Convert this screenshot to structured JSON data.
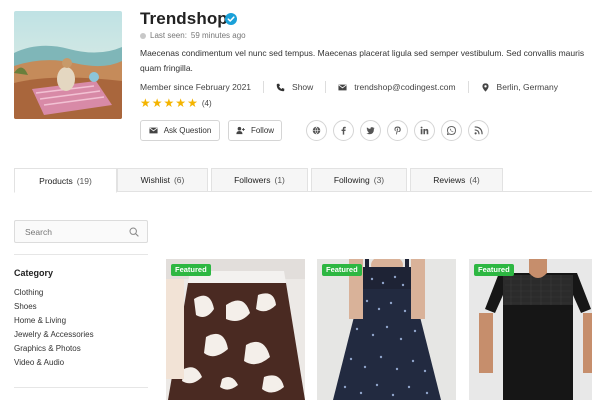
{
  "profile": {
    "name": "Trendshop",
    "last_seen_label": "Last seen:",
    "last_seen_value": "59 minutes ago",
    "bio": "Maecenas condimentum vel nunc sed tempus. Maecenas placerat ligula sed semper vestibulum. Sed convallis mauris quam fringilla.",
    "member_since": "Member since February 2021",
    "phone_label": "Show",
    "email": "trendshop@codingest.com",
    "location": "Berlin, Germany",
    "rating_stars": 5,
    "rating_count": "(4)"
  },
  "actions": {
    "ask_question": "Ask Question",
    "follow": "Follow"
  },
  "social_icons": [
    "globe-icon",
    "facebook-icon",
    "twitter-icon",
    "pinterest-icon",
    "linkedin-icon",
    "whatsapp-icon",
    "rss-icon"
  ],
  "tabs": [
    {
      "label": "Products",
      "count": "(19)",
      "active": true
    },
    {
      "label": "Wishlist",
      "count": "(6)",
      "active": false
    },
    {
      "label": "Followers",
      "count": "(1)",
      "active": false
    },
    {
      "label": "Following",
      "count": "(3)",
      "active": false
    },
    {
      "label": "Reviews",
      "count": "(4)",
      "active": false
    }
  ],
  "sidebar": {
    "search_placeholder": "Search",
    "category_title": "Category",
    "categories": [
      "Clothing",
      "Shoes",
      "Home & Living",
      "Jewelry & Accessories",
      "Graphics & Photos",
      "Video & Audio"
    ]
  },
  "products": [
    {
      "badge": "Featured"
    },
    {
      "badge": "Featured"
    },
    {
      "badge": "Featured"
    }
  ],
  "colors": {
    "star": "#f4b400",
    "badge": "#2db742",
    "verified": "#1aa0d8"
  }
}
